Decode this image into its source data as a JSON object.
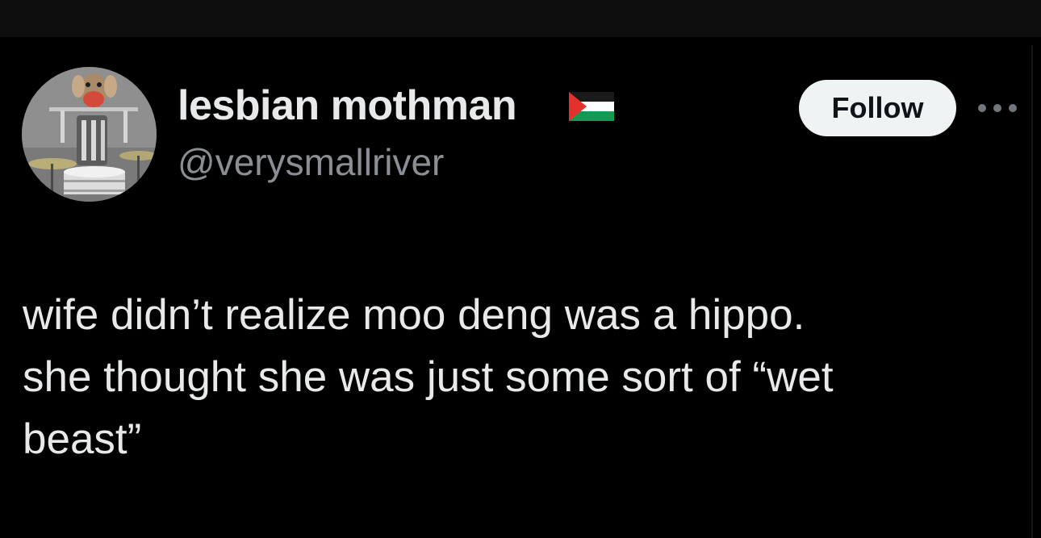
{
  "colors": {
    "background": "#000000",
    "top_bar": "#0e0e0e",
    "text_primary": "#e7e9ea",
    "text_secondary": "#8b8f94",
    "follow_button_bg": "#eff3f4",
    "follow_button_text": "#0f1419"
  },
  "author": {
    "display_name": "lesbian mothman",
    "display_name_emoji": "palestine-flag-icon",
    "handle": "@verysmallriver",
    "avatar_icon": "avatar-puppet-drummer"
  },
  "actions": {
    "follow_label": "Follow",
    "more_icon": "more-horizontal-icon"
  },
  "tweet": {
    "lines": [
      "wife didn’t realize moo deng was a hippo.",
      "she thought she was just some sort of “wet",
      "beast”"
    ]
  }
}
